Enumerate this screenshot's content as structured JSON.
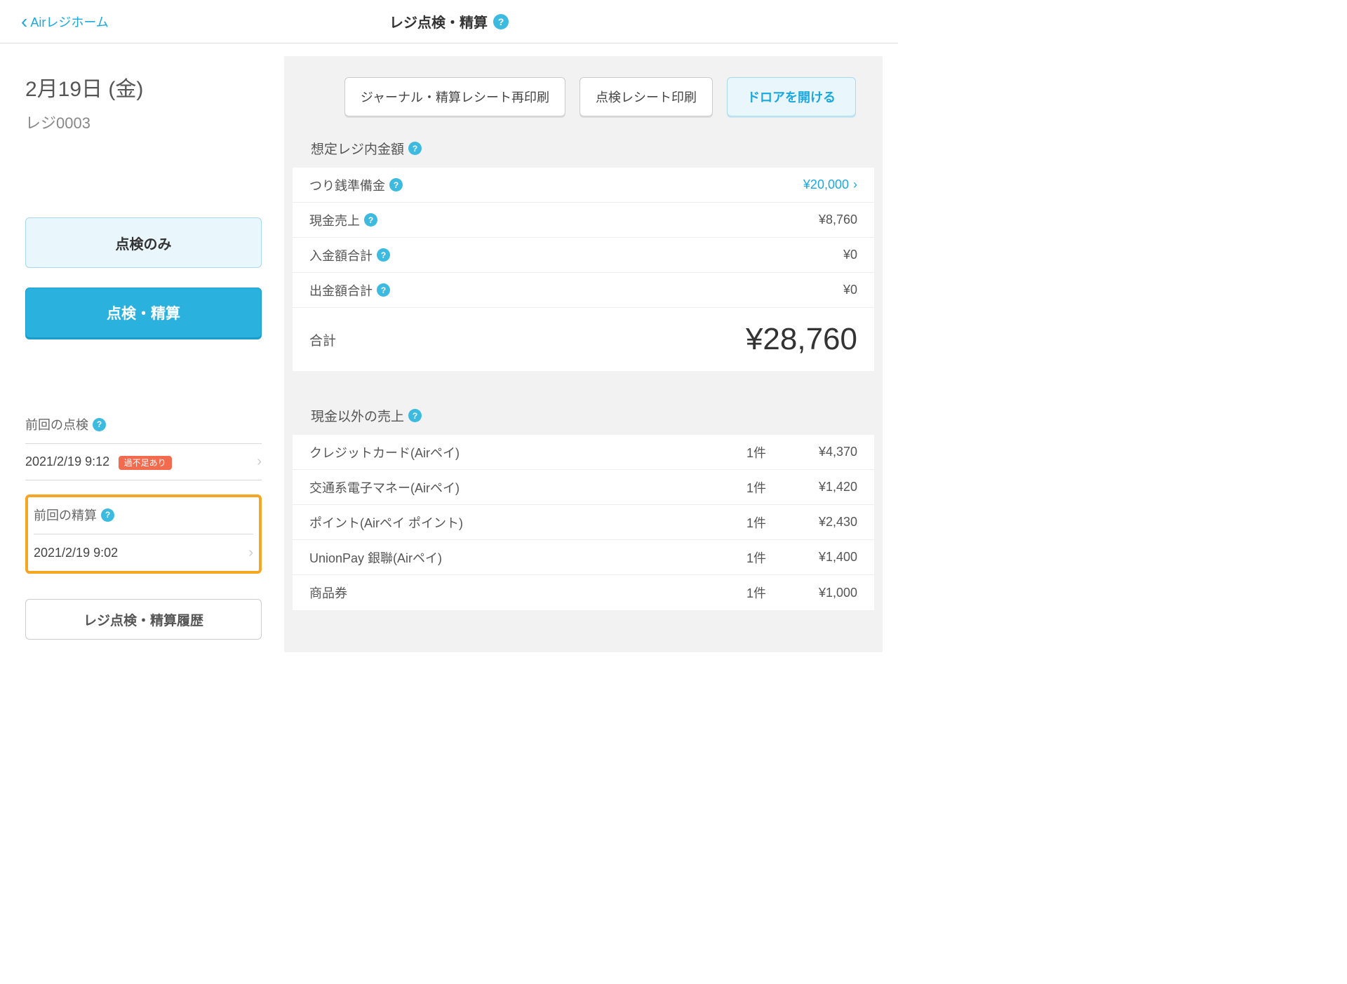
{
  "header": {
    "back_label": "Airレジホーム",
    "title": "レジ点検・精算"
  },
  "sidebar": {
    "date": "2月19日 (金)",
    "register": "レジ0003",
    "check_only_btn": "点検のみ",
    "check_settle_btn": "点検・精算",
    "prev_check_label": "前回の点検",
    "prev_check_time": "2021/2/19 9:12",
    "prev_check_badge": "過不足あり",
    "prev_settle_label": "前回の精算",
    "prev_settle_time": "2021/2/19 9:02",
    "history_btn": "レジ点検・精算履歴"
  },
  "main": {
    "actions": {
      "reprint": "ジャーナル・精算レシート再印刷",
      "print_check": "点検レシート印刷",
      "open_drawer": "ドロアを開ける"
    },
    "expected_title": "想定レジ内金額",
    "expected": {
      "change_fund_label": "つり銭準備金",
      "change_fund_value": "¥20,000",
      "cash_sales_label": "現金売上",
      "cash_sales_value": "¥8,760",
      "deposit_label": "入金額合計",
      "deposit_value": "¥0",
      "withdrawal_label": "出金額合計",
      "withdrawal_value": "¥0",
      "total_label": "合計",
      "total_value": "¥28,760"
    },
    "noncash_title": "現金以外の売上",
    "noncash": [
      {
        "name": "クレジットカード(Airペイ)",
        "count": "1件",
        "amount": "¥4,370"
      },
      {
        "name": "交通系電子マネー(Airペイ)",
        "count": "1件",
        "amount": "¥1,420"
      },
      {
        "name": "ポイント(Airペイ ポイント)",
        "count": "1件",
        "amount": "¥2,430"
      },
      {
        "name": "UnionPay 銀聯(Airペイ)",
        "count": "1件",
        "amount": "¥1,400"
      },
      {
        "name": "商品券",
        "count": "1件",
        "amount": "¥1,000"
      }
    ]
  }
}
